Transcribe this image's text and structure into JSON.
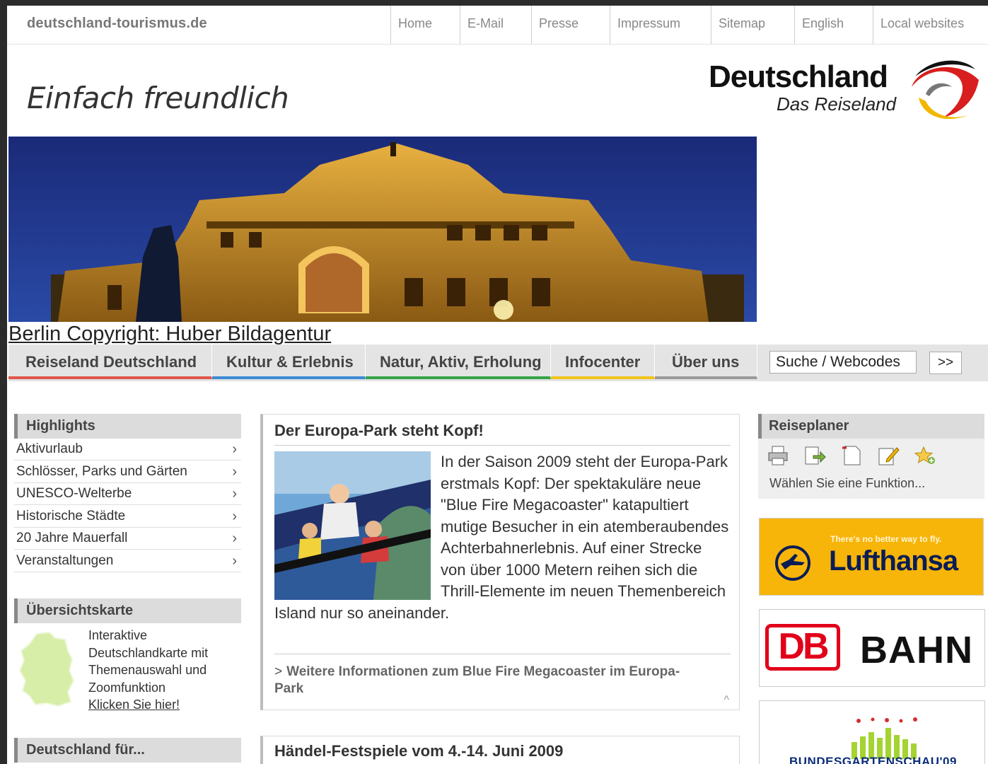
{
  "site": {
    "url": "deutschland-tourismus.de"
  },
  "topnav": [
    "Home",
    "E-Mail",
    "Presse",
    "Impressum",
    "Sitemap",
    "English",
    "Local websites"
  ],
  "header": {
    "slogan": "Einfach freundlich",
    "logo_title": "Deutschland",
    "logo_subtitle": "Das Reiseland"
  },
  "hero": {
    "caption": "Berlin Copyright: Huber Bildagentur"
  },
  "mainnav": {
    "items": [
      "Reiseland Deutschland",
      "Kultur & Erlebnis",
      "Natur, Aktiv, Erholung",
      "Infocenter",
      "Über uns"
    ],
    "search_label": "Suche / Webcodes",
    "go_label": ">>"
  },
  "highlights": {
    "title": "Highlights",
    "items": [
      "Aktivurlaub",
      "Schlösser, Parks und Gärten",
      "UNESCO-Welterbe",
      "Historische Städte",
      "20 Jahre Mauerfall",
      "Veranstaltungen"
    ],
    "chevron": "›"
  },
  "uebersichtskarte": {
    "title": "Übersichtskarte",
    "text": "Interaktive Deutschlandkarte mit Themenauswahl und Zoomfunktion",
    "link": "Klicken Sie hier!"
  },
  "deutschland_fuer": {
    "title": "Deutschland für..."
  },
  "article": {
    "title": "Der Europa-Park steht Kopf!",
    "body": "In der Saison 2009 steht der Europa-Park erstmals Kopf: Der spektakuläre neue \"Blue Fire Megacoaster\" katapultiert mutige Besucher in ein atemberaubendes Achterbahnerlebnis. Auf einer Strecke von über 1000 Metern reihen sich die Thrill-Elemente im neuen Themenbereich Island nur so aneinander.",
    "more_link": "Weitere Informationen zum Blue Fire Megacoaster im Europa-Park",
    "more_chevron": ">",
    "top_arrow": "^"
  },
  "article2": {
    "title": "Händel-Festspiele vom 4.-14. Juni 2009"
  },
  "reiseplaner": {
    "title": "Reiseplaner",
    "icons": [
      "print-icon",
      "export-icon",
      "note-icon",
      "edit-icon",
      "add-favorite-icon"
    ],
    "hint": "Wählen Sie eine Funktion..."
  },
  "ads": {
    "lufthansa_tagline": "There's no better way to fly.",
    "lufthansa_name": "Lufthansa",
    "db_logo": "DB",
    "db_name": "BAHN",
    "bga_name": "BUNDESGARTENSCHAU'09"
  },
  "colors": {
    "nav_reiseland": "#e0564b",
    "nav_kultur": "#3a8ad4",
    "nav_natur": "#36a447",
    "nav_infocenter": "#f0c419",
    "nav_ueber": "#9a9a9a",
    "lufthansa_yellow": "#f8b509",
    "db_red": "#e2001a"
  }
}
